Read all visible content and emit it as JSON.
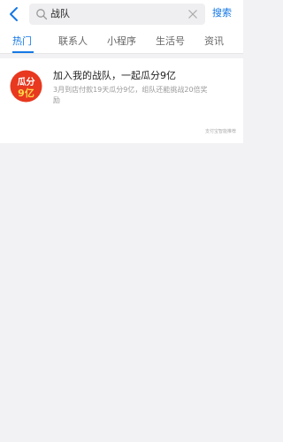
{
  "search": {
    "query": "战队",
    "button_label": "搜索"
  },
  "tabs": [
    {
      "label": "热门",
      "active": true
    },
    {
      "label": "联系人",
      "active": false
    },
    {
      "label": "小程序",
      "active": false
    },
    {
      "label": "生活号",
      "active": false
    },
    {
      "label": "资讯",
      "active": false
    }
  ],
  "result": {
    "logo_text_top": "瓜分",
    "logo_text_bottom": "9亿",
    "title": "加入我的战队，一起瓜分9亿",
    "description": "3月到店付款19天瓜分9亿，组队还能挑战20倍奖励",
    "source": "支付宝智能推荐"
  },
  "colors": {
    "accent": "#1478e6",
    "logo_red": "#e8381f"
  }
}
